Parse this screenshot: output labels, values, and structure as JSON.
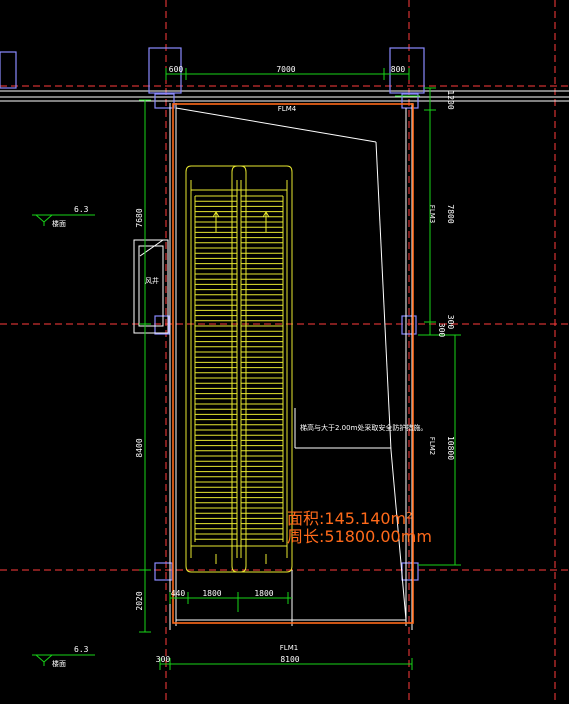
{
  "labels": {
    "flm4": "FLM4",
    "flm3": "FLM3",
    "flm2": "FLM2",
    "flm1": "FLM1",
    "note": "梯高与大于2.00m处采取安全防护措施。",
    "level_upper": "6.3",
    "level_lower": "6.3",
    "level_tag_upper": "楼面",
    "level_tag_lower": "楼面",
    "wall_tag": "风井"
  },
  "dimensions": {
    "top_left": "600",
    "top_mid": "7000",
    "top_right": "800",
    "bottom_left": "300",
    "bottom_mid": "8100",
    "left_upper": "7680",
    "left_mid": "8400",
    "left_lower": "2020",
    "right_top": "1200",
    "right_upper": "7800",
    "right_mid": "300",
    "right_mid2": "300",
    "right_lower": "10800",
    "bottom_inner_a": "440",
    "bottom_inner_b": "1800",
    "bottom_inner_c": "1800"
  },
  "area": {
    "area_text": "面积:145.140m²",
    "perimeter_text": "周长:51800.00mm"
  },
  "colors": {
    "background": "#000000",
    "axis": "#ff3b3b",
    "dimension": "#18d418",
    "wall": "#ffffff",
    "column": "#8a8aff",
    "escalator": "#e8e830",
    "boundary": "#ff6a1a",
    "text": "#ffffff"
  }
}
